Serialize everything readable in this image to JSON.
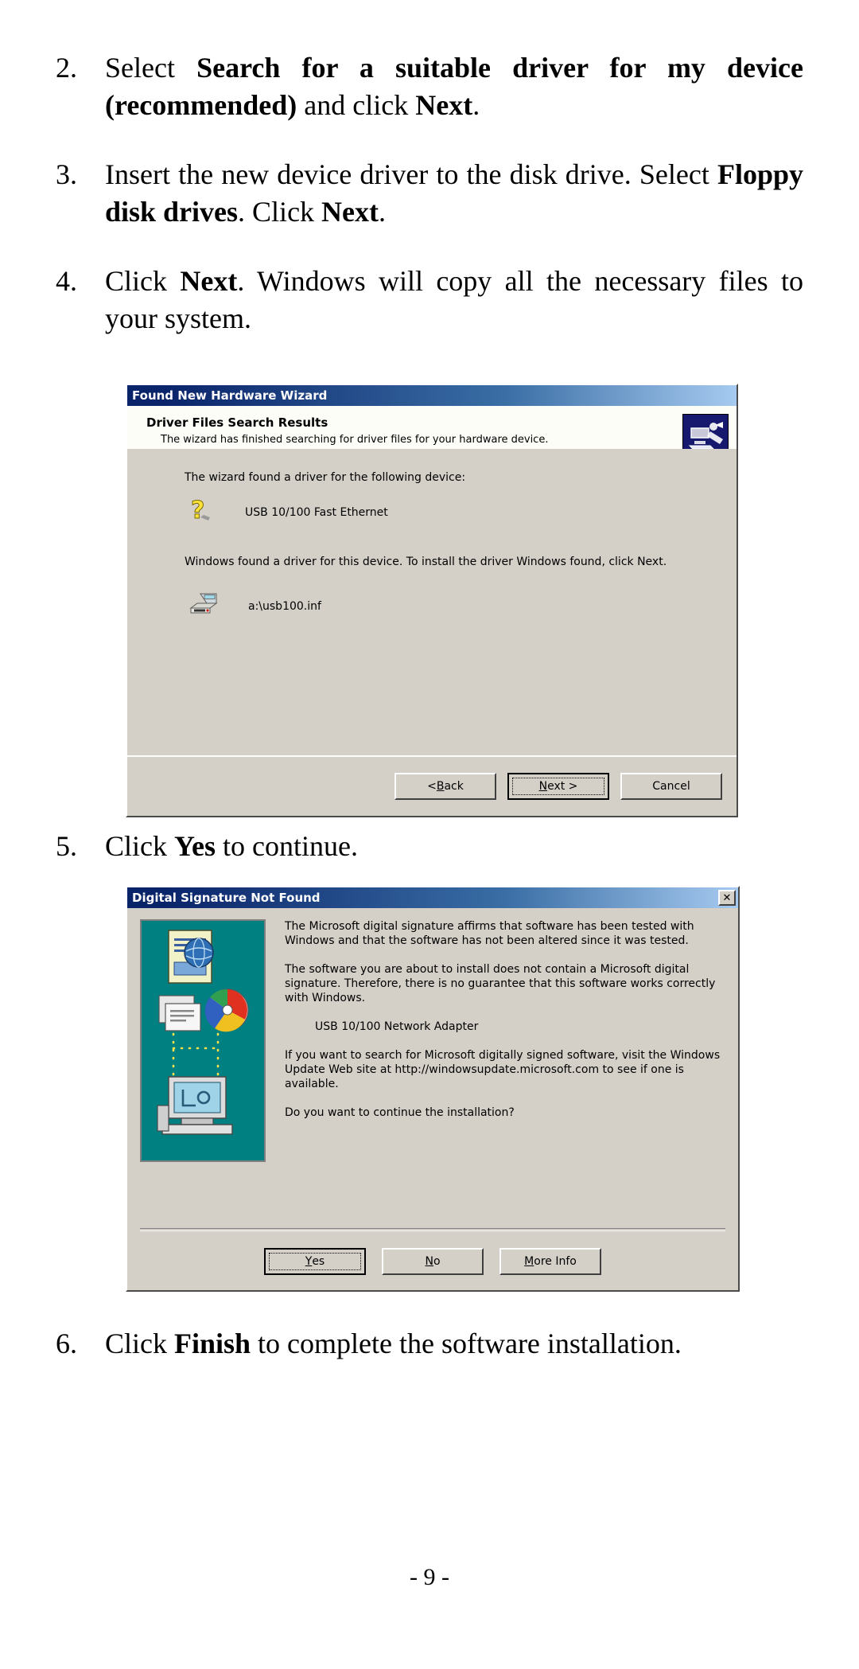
{
  "document": {
    "page_number": "- 9 -",
    "steps": [
      {
        "number": "2.",
        "segments": [
          {
            "text": "Select ",
            "bold": false
          },
          {
            "text": "Search for a suitable driver for my device (recommended)",
            "bold": true
          },
          {
            "text": " and click ",
            "bold": false
          },
          {
            "text": "Next",
            "bold": true
          },
          {
            "text": ".",
            "bold": false
          }
        ]
      },
      {
        "number": "3.",
        "segments": [
          {
            "text": "Insert the new device driver to the disk drive. Select ",
            "bold": false
          },
          {
            "text": "Floppy disk drives",
            "bold": true
          },
          {
            "text": ". Click ",
            "bold": false
          },
          {
            "text": "Next",
            "bold": true
          },
          {
            "text": ".",
            "bold": false
          }
        ]
      },
      {
        "number": "4.",
        "segments": [
          {
            "text": "Click ",
            "bold": false
          },
          {
            "text": "Next",
            "bold": true
          },
          {
            "text": ".   Windows will copy all the necessary files to your system.",
            "bold": false
          }
        ]
      },
      {
        "number": "5.",
        "segments": [
          {
            "text": "Click ",
            "bold": false
          },
          {
            "text": "Yes",
            "bold": true
          },
          {
            "text": " to continue.",
            "bold": false
          }
        ]
      },
      {
        "number": "6.",
        "segments": [
          {
            "text": "Click ",
            "bold": false
          },
          {
            "text": "Finish",
            "bold": true
          },
          {
            "text": " to complete the software installation.",
            "bold": false
          }
        ]
      }
    ]
  },
  "wizard_dialog": {
    "title": "Found New Hardware Wizard",
    "header_heading": "Driver Files Search Results",
    "header_sub": "The wizard has finished searching for driver files for your hardware device.",
    "body_line1": "The wizard found a driver for the following device:",
    "device_name": "USB 10/100 Fast Ethernet",
    "body_line2": "Windows found a driver for this device. To install the driver Windows found, click Next.",
    "driver_path": "a:\\usb100.inf",
    "buttons": {
      "back_prefix": "< ",
      "back_accel": "B",
      "back_rest": "ack",
      "next_prefix": "",
      "next_accel": "N",
      "next_rest": "ext >",
      "cancel": "Cancel"
    }
  },
  "signature_dialog": {
    "title": "Digital Signature Not Found",
    "close_label": "✕",
    "paragraph1": "The Microsoft digital signature affirms that software has been tested with Windows and that the software has not been altered since it was tested.",
    "paragraph2": "The software you are about to install does not contain a Microsoft digital signature. Therefore, there is no guarantee that this software works correctly with Windows.",
    "device_name": "USB 10/100 Network Adapter",
    "paragraph3": "If you want to search for Microsoft digitally signed software, visit the Windows Update Web site at http://windowsupdate.microsoft.com to see if one is available.",
    "paragraph4": "Do you want to continue the installation?",
    "buttons": {
      "yes_accel": "Y",
      "yes_rest": "es",
      "no_accel": "N",
      "no_rest": "o",
      "more_info_accel": "M",
      "more_info_rest": "ore Info"
    }
  },
  "colors": {
    "title_bar_start": "#0a246a",
    "title_bar_end": "#a6caf0",
    "dialog_face": "#d4d0c8",
    "wizard_header_bg": "#fdfdf8",
    "art_background": "#008080",
    "question_icon": "#ffe33a"
  }
}
